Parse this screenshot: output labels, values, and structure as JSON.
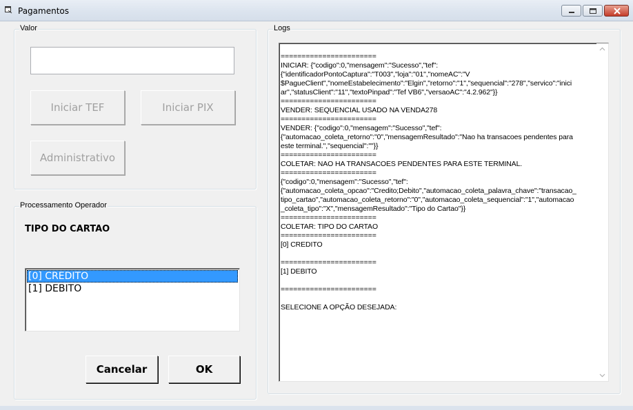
{
  "window": {
    "title": "Pagamentos",
    "icon": "window-app-icon",
    "controls": [
      "minimize-icon",
      "maximize-icon",
      "close-icon"
    ]
  },
  "valor": {
    "group_label": "Valor",
    "input_value": "",
    "buttons": {
      "iniciar_tef": "Iniciar TEF",
      "iniciar_pix": "Iniciar PIX",
      "administrativo": "Administrativo"
    }
  },
  "processamento": {
    "group_label": "Processamento Operador",
    "prompt": "TIPO DO CARTAO",
    "options": [
      "[0] CREDITO",
      "[1] DEBITO"
    ],
    "selected_index": 0,
    "cancel_label": "Cancelar",
    "ok_label": "OK"
  },
  "logs": {
    "group_label": "Logs",
    "lines": [
      "=======================",
      "INICIAR: {\"codigo\":0,\"mensagem\":\"Sucesso\",\"tef\":",
      "{\"identificadorPontoCaptura\":\"T003\",\"loja\":\"01\",\"nomeAC\":\"V",
      "$PagueClient\",\"nomeEstabelecimento\":\"Elgin\",\"retorno\":\"1\",\"sequencial\":\"278\",\"servico\":\"inici",
      "ar\",\"statusClient\":\"11\",\"textoPinpad\":\"Tef VB6\",\"versaoAC\":\"4.2.962\"}}",
      "=======================",
      "VENDER: SEQUENCIAL USADO NA VENDA278",
      "=======================",
      "VENDER: {\"codigo\":0,\"mensagem\":\"Sucesso\",\"tef\":",
      "{\"automacao_coleta_retorno\":\"0\",\"mensagemResultado\":\"Nao ha transacoes pendentes para",
      "este terminal.\",\"sequencial\":\"\"}}",
      "=======================",
      "COLETAR: NAO HA TRANSACOES PENDENTES PARA ESTE TERMINAL.",
      "=======================",
      "{\"codigo\":0,\"mensagem\":\"Sucesso\",\"tef\":",
      "{\"automacao_coleta_opcao\":\"Credito;Debito\",\"automacao_coleta_palavra_chave\":\"transacao_",
      "tipo_cartao\",\"automacao_coleta_retorno\":\"0\",\"automacao_coleta_sequencial\":\"1\",\"automacao",
      "_coleta_tipo\":\"X\",\"mensagemResultado\":\"Tipo do Cartao\"}}",
      "=======================",
      "COLETAR: TIPO DO CARTAO",
      "=======================",
      "[0] CREDITO",
      "",
      "=======================",
      "[1] DEBITO",
      "",
      "=======================",
      "",
      "SELECIONE A OPÇÃO DESEJADA:"
    ]
  }
}
